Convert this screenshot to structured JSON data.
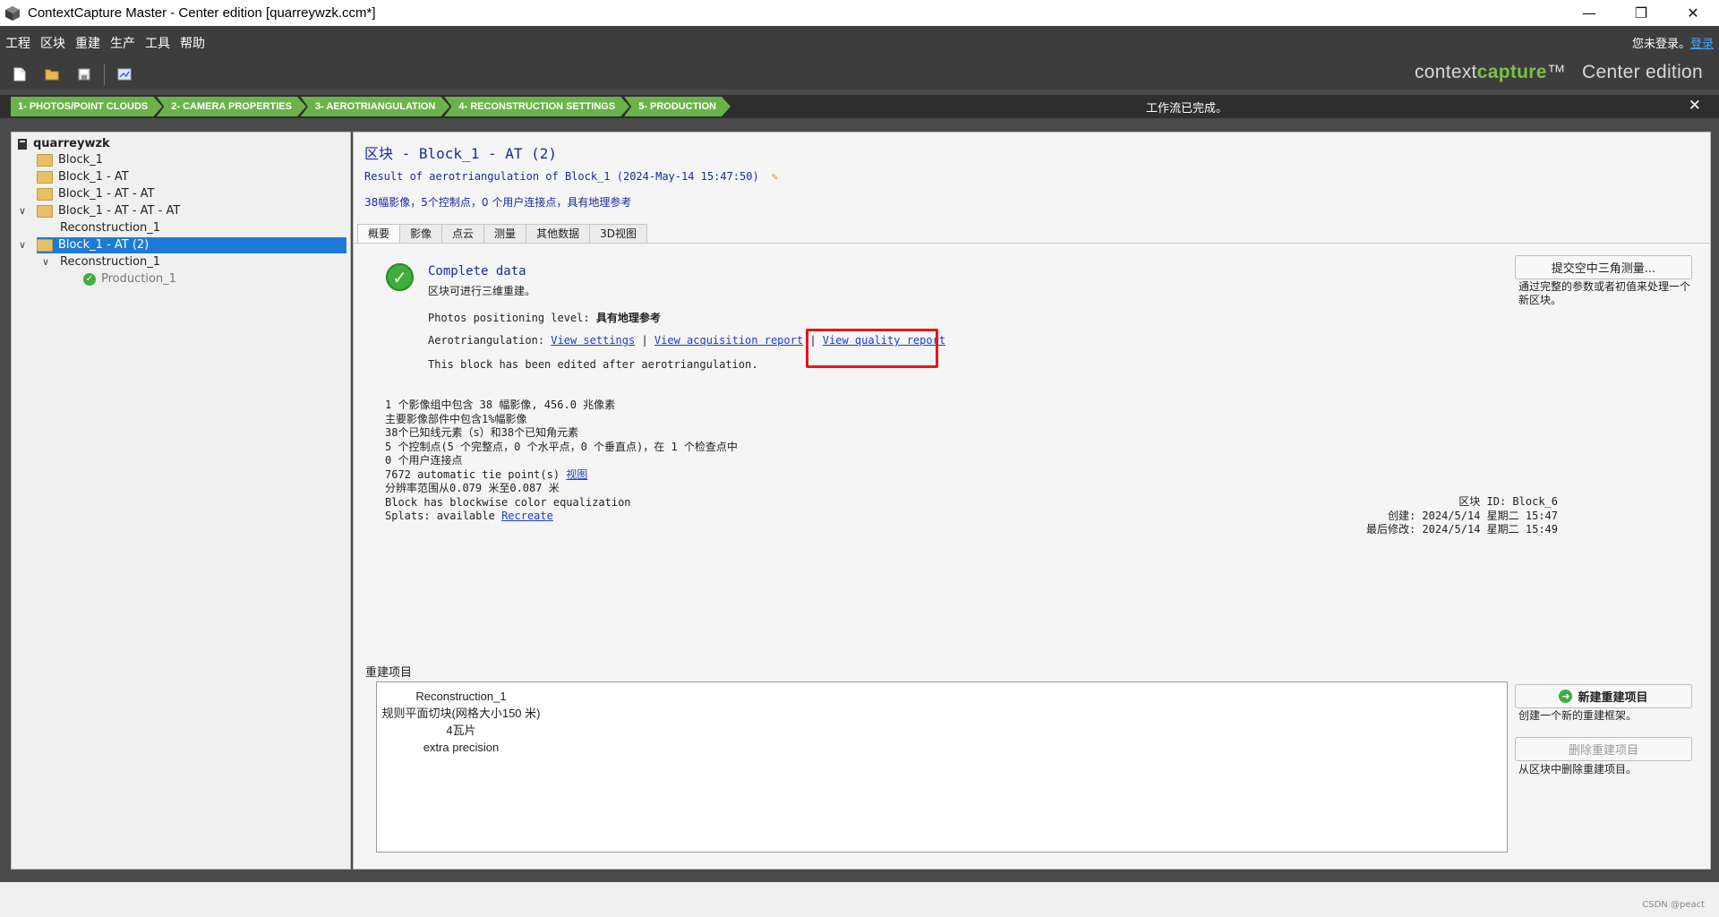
{
  "window": {
    "title": "ContextCapture Master - Center edition [quarreywzk.ccm*]",
    "minimize": "—",
    "maximize": "❐",
    "close": "✕"
  },
  "menu": {
    "items": [
      "工程",
      "区块",
      "重建",
      "生产",
      "工具",
      "帮助"
    ],
    "login_text": "您未登录。",
    "login_link": "登录"
  },
  "toolbar": {
    "icons": [
      "new-file-icon",
      "open-folder-icon",
      "save-icon",
      "screenshot-icon"
    ],
    "brand_light": "context",
    "brand_bold": "capture",
    "brand_tm": "™",
    "edition": "Center edition"
  },
  "workflow": {
    "steps": [
      "1- PHOTOS/POINT CLOUDS",
      "2- CAMERA PROPERTIES",
      "3- AEROTRIANGULATION",
      "4- RECONSTRUCTION SETTINGS",
      "5- PRODUCTION"
    ],
    "status": "工作流已完成。",
    "close": "✕"
  },
  "tree": {
    "root": "quarreywzk",
    "items": [
      "Block_1",
      "Block_1 - AT",
      "Block_1 - AT - AT",
      "Block_1 - AT - AT - AT",
      "Reconstruction_1",
      "Block_1 - AT (2)",
      "Reconstruction_1",
      "Production_1"
    ]
  },
  "main": {
    "title": "区块 - Block_1 - AT (2)",
    "result_line": "Result of aerotriangulation of Block_1 (2024-May-14 15:47:50)",
    "summary_line": "38幅影像，5个控制点，0 个用户连接点，具有地理参考",
    "tabs": [
      "概要",
      "影像",
      "点云",
      "测量",
      "其他数据",
      "3D视图"
    ],
    "complete_title": "Complete data",
    "can_rebuild": "区块可进行三维重建。",
    "pos_label": "Photos positioning level:",
    "pos_value": "具有地理参考",
    "aero_label": "Aerotriangulation:",
    "link_settings": "View settings",
    "link_acq": "View acquisition report",
    "link_quality": "View quality report",
    "sep": "|",
    "edited": "This block has been edited after aerotriangulation.",
    "stats": [
      "1 个影像组中包含 38 幅影像, 456.0 兆像素",
      "主要影像部件中包含1%幅影像",
      "38个已知线元素（s）和38个已知角元素",
      "5 个控制点(5 个完整点，0 个水平点，0 个垂直点)，在 1 个检查点中",
      "0 个用户连接点",
      "7672 automatic tie point(s)",
      "分辨率范围从0.079 米至0.087 米",
      "Block has blockwise color equalization",
      "Splats: available"
    ],
    "view_link": "视图",
    "recreate_link": "Recreate",
    "meta": {
      "id_line": "区块 ID: Block_6",
      "created": "创建: 2024/5/14 星期二 15:47",
      "modified": "最后修改: 2024/5/14 星期二 15:49"
    },
    "submit_btn": "提交空中三角测量...",
    "submit_desc": "通过完整的参数或者初值来处理一个新区块。",
    "recon_label": "重建项目",
    "recon_item": {
      "name": "Reconstruction_1",
      "tiling": "规则平面切块(网格大小150 米)",
      "tiles": "4瓦片",
      "precision": "extra precision"
    },
    "new_recon_btn": "新建重建项目",
    "new_recon_desc": "创建一个新的重建框架。",
    "delete_recon_btn": "删除重建项目",
    "delete_recon_desc": "从区块中删除重建项目。"
  },
  "statusbar": {
    "watermark": "CSDN @peact"
  },
  "colors": {
    "workflow_green": "#6ab34a",
    "selected_blue": "#1f7ad6",
    "link_blue": "#1a3ccf",
    "highlight_red": "#e8161c"
  }
}
